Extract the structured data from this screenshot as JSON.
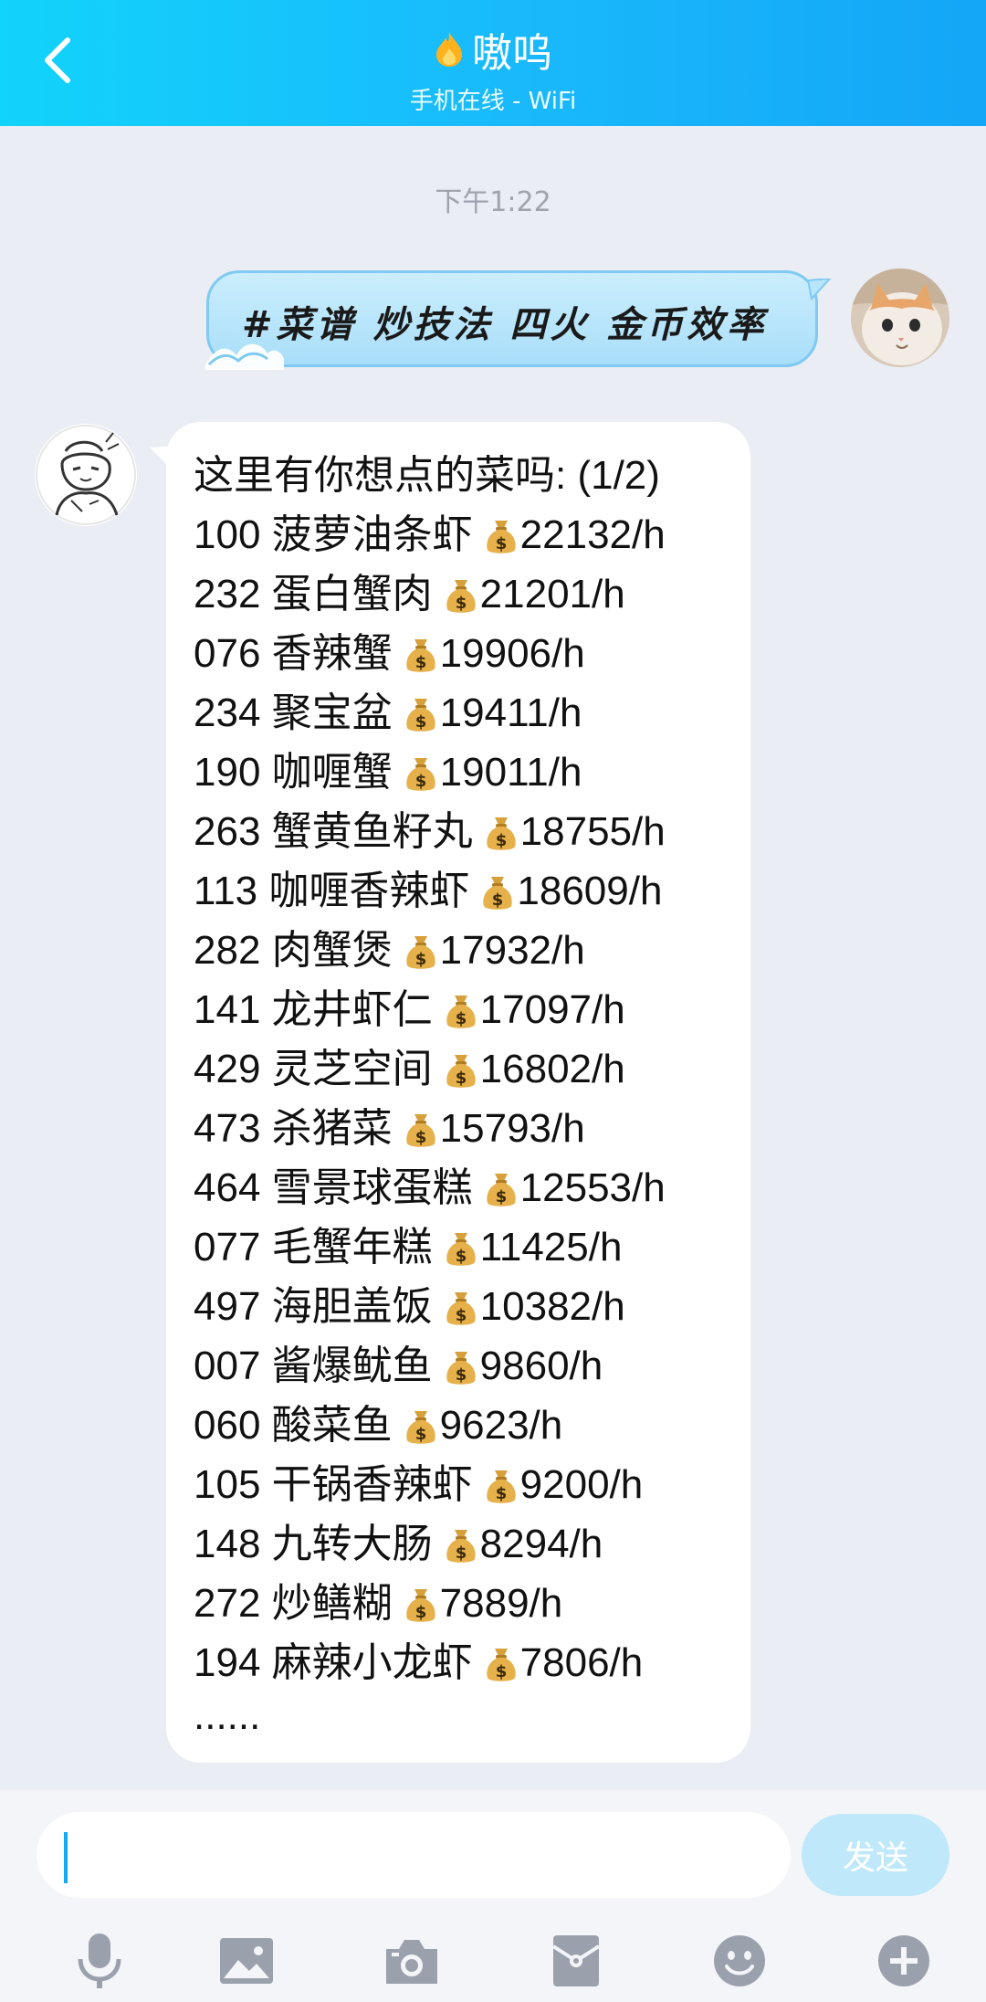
{
  "header": {
    "title": "嗷呜",
    "subtitle": "手机在线 - WiFi"
  },
  "chat": {
    "timestamp": "下午1:22",
    "sent_message": "#菜谱 炒技法 四火 金币效率",
    "reply_header": "这里有你想点的菜吗: (1/2)",
    "reply_items": [
      {
        "id": "100",
        "name": "菠萝油条虾",
        "rate": "22132/h"
      },
      {
        "id": "232",
        "name": "蛋白蟹肉",
        "rate": "21201/h"
      },
      {
        "id": "076",
        "name": "香辣蟹",
        "rate": "19906/h"
      },
      {
        "id": "234",
        "name": "聚宝盆",
        "rate": "19411/h"
      },
      {
        "id": "190",
        "name": "咖喱蟹",
        "rate": "19011/h"
      },
      {
        "id": "263",
        "name": "蟹黄鱼籽丸",
        "rate": "18755/h"
      },
      {
        "id": "113",
        "name": "咖喱香辣虾",
        "rate": "18609/h"
      },
      {
        "id": "282",
        "name": "肉蟹煲",
        "rate": "17932/h"
      },
      {
        "id": "141",
        "name": "龙井虾仁",
        "rate": "17097/h"
      },
      {
        "id": "429",
        "name": "灵芝空间",
        "rate": "16802/h"
      },
      {
        "id": "473",
        "name": "杀猪菜",
        "rate": "15793/h"
      },
      {
        "id": "464",
        "name": "雪景球蛋糕",
        "rate": "12553/h"
      },
      {
        "id": "077",
        "name": "毛蟹年糕",
        "rate": "11425/h"
      },
      {
        "id": "497",
        "name": "海胆盖饭",
        "rate": "10382/h"
      },
      {
        "id": "007",
        "name": "酱爆鱿鱼",
        "rate": "9860/h"
      },
      {
        "id": "060",
        "name": "酸菜鱼",
        "rate": "9623/h"
      },
      {
        "id": "105",
        "name": "干锅香辣虾",
        "rate": "9200/h"
      },
      {
        "id": "148",
        "name": "九转大肠",
        "rate": "8294/h"
      },
      {
        "id": "272",
        "name": "炒鳝糊",
        "rate": "7889/h"
      },
      {
        "id": "194",
        "name": "麻辣小龙虾",
        "rate": "7806/h"
      }
    ],
    "reply_footer": "......"
  },
  "input": {
    "value": "",
    "send_label": "发送"
  },
  "toolbar": {
    "icons": [
      "microphone-icon",
      "image-icon",
      "camera-icon",
      "red-packet-icon",
      "emoji-icon",
      "plus-icon"
    ]
  },
  "colors": {
    "header_start": "#12d3fb",
    "header_end": "#14a6f7",
    "send_button": "#bfe9fb",
    "sent_bubble": "#b8e5fb",
    "chat_background": "#eaedf4"
  }
}
